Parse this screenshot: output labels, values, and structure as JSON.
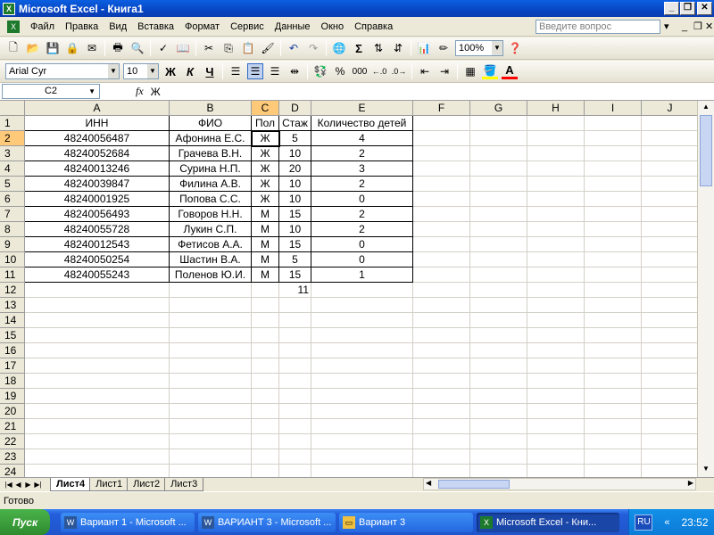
{
  "window": {
    "title": "Microsoft Excel - Книга1"
  },
  "menu": [
    "Файл",
    "Правка",
    "Вид",
    "Вставка",
    "Формат",
    "Сервис",
    "Данные",
    "Окно",
    "Справка"
  ],
  "ask_placeholder": "Введите вопрос",
  "toolbar": {
    "zoom": "100%",
    "font": "Arial Cyr",
    "size": "10",
    "bold": "Ж",
    "italic": "К",
    "underline": "Ч",
    "percent": "%",
    "thousands": "000"
  },
  "namebox": "C2",
  "fx": "fx",
  "formula": "Ж",
  "columns": [
    "A",
    "B",
    "C",
    "D",
    "E",
    "F",
    "G",
    "H",
    "I",
    "J"
  ],
  "rows": [
    "1",
    "2",
    "3",
    "4",
    "5",
    "6",
    "7",
    "8",
    "9",
    "10",
    "11",
    "12",
    "13",
    "14",
    "15",
    "16",
    "17",
    "18",
    "19",
    "20",
    "21",
    "22",
    "23",
    "24"
  ],
  "headers": [
    "ИНН",
    "ФИО",
    "Пол",
    "Стаж",
    "Количество детей"
  ],
  "data": [
    [
      "48240056487",
      "Афонина Е.С.",
      "Ж",
      "5",
      "4"
    ],
    [
      "48240052684",
      "Грачева В.Н.",
      "Ж",
      "10",
      "2"
    ],
    [
      "48240013246",
      "Сурина Н.П.",
      "Ж",
      "20",
      "3"
    ],
    [
      "48240039847",
      "Филина А.В.",
      "Ж",
      "10",
      "2"
    ],
    [
      "48240001925",
      "Попова С.С.",
      "Ж",
      "10",
      "0"
    ],
    [
      "48240056493",
      "Говоров Н.Н.",
      "М",
      "15",
      "2"
    ],
    [
      "48240055728",
      "Лукин С.П.",
      "М",
      "10",
      "2"
    ],
    [
      "48240012543",
      "Фетисов А.А.",
      "М",
      "15",
      "0"
    ],
    [
      "48240050254",
      "Шастин В.А.",
      "М",
      "5",
      "0"
    ],
    [
      "48240055243",
      "Поленов Ю.И.",
      "М",
      "15",
      "1"
    ]
  ],
  "d12": "11",
  "sheets": [
    "Лист4",
    "Лист1",
    "Лист2",
    "Лист3"
  ],
  "status": "Готово",
  "taskbar": {
    "start": "Пуск",
    "items": [
      "Вариант 1 - Microsoft ...",
      "ВАРИАНТ 3 - Microsoft ...",
      "Вариант 3",
      "Microsoft Excel - Кни..."
    ],
    "lang": "RU",
    "clock": "23:52"
  }
}
